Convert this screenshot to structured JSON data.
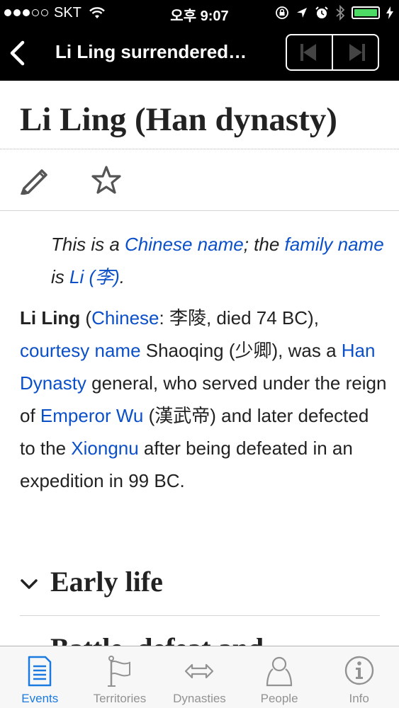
{
  "status": {
    "carrier": "SKT",
    "time": "오후 9:07"
  },
  "nav": {
    "title": "Li Ling surrendered…"
  },
  "article": {
    "title": "Li Ling (Han dynasty)",
    "hatnote": {
      "p1": "This is a ",
      "link1": "Chinese name",
      "p2": "; the ",
      "link2": "family name",
      "p3": " is ",
      "link3": "Li (李)",
      "p4": "."
    },
    "lead": {
      "bold": "Li Ling",
      "t1": " (",
      "l1": "Chinese",
      "t2": ": 李陵, died 74 BC), ",
      "l2": "courtesy name",
      "t3": " Shaoqing (少卿), was a ",
      "l3": "Han Dynasty",
      "t4": " general, who served under the reign of ",
      "l4": "Emperor Wu",
      "t5": " (漢武帝) and later defected to the ",
      "l5": "Xiongnu",
      "t6": " after being defeated in an expedition in 99 BC."
    },
    "sections": [
      "Early life",
      "Battle, defeat and"
    ]
  },
  "tabs": [
    {
      "label": "Events",
      "icon": "events-icon",
      "active": true
    },
    {
      "label": "Territories",
      "icon": "flag-icon"
    },
    {
      "label": "Dynasties",
      "icon": "exchange-arrows-icon"
    },
    {
      "label": "People",
      "icon": "person-icon"
    },
    {
      "label": "Info",
      "icon": "info-icon"
    }
  ],
  "colors": {
    "link": "#0b50c8",
    "tab_active": "#1a7ae0",
    "tab_inactive": "#929292",
    "battery": "#4cd964"
  }
}
